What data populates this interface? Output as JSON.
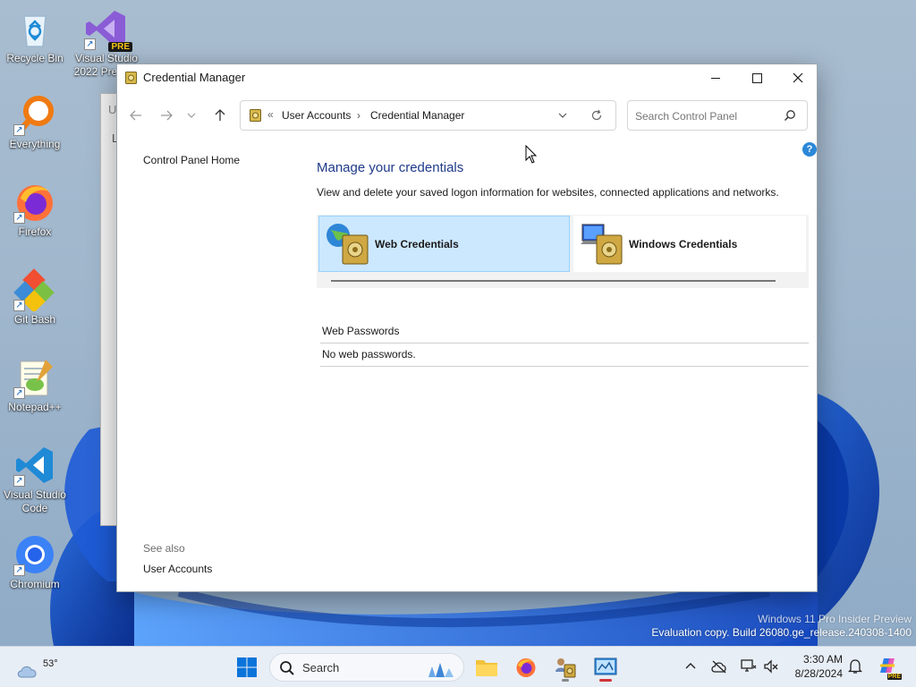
{
  "desktop": {
    "icons": [
      {
        "label": "Recycle Bin"
      },
      {
        "label": "Visual Studio 2022 Preview",
        "badge": "PRE"
      },
      {
        "label": "Everything"
      },
      {
        "label": "Firefox"
      },
      {
        "label": "Git Bash"
      },
      {
        "label": "Notepad++"
      },
      {
        "label": "Visual Studio Code"
      },
      {
        "label": "Chromium"
      }
    ],
    "background_window": {
      "title_fragment": "U",
      "text_fragment": "L"
    }
  },
  "window": {
    "title": "Credential Manager",
    "address": {
      "prefix": "«",
      "crumbs": [
        "User Accounts",
        "Credential Manager"
      ],
      "separator": "›"
    },
    "search": {
      "placeholder": "Search Control Panel"
    },
    "left_pane": {
      "home_link": "Control Panel Home",
      "see_also_title": "See also",
      "see_also_link": "User Accounts"
    },
    "help": "?",
    "main": {
      "heading": "Manage your credentials",
      "description": "View and delete your saved logon information for websites, connected applications and networks.",
      "tiles": [
        {
          "label": "Web Credentials",
          "selected": true
        },
        {
          "label": "Windows Credentials",
          "selected": false
        }
      ],
      "section_title": "Web Passwords",
      "section_empty": "No web passwords."
    }
  },
  "watermark": {
    "line1": "Windows 11 Pro Insider Preview",
    "line2": "Evaluation copy. Build 26080.ge_release.240308-1400"
  },
  "taskbar": {
    "weather_temp": "53°",
    "search_label": "Search",
    "clock_time": "3:30 AM",
    "clock_date": "8/28/2024",
    "copilot_badge": "PRE"
  },
  "colors": {
    "accent": "#0067c0",
    "heading_blue": "#1e3a8a",
    "selected_tile": "#cce8ff",
    "help_blue": "#2b88d8"
  }
}
